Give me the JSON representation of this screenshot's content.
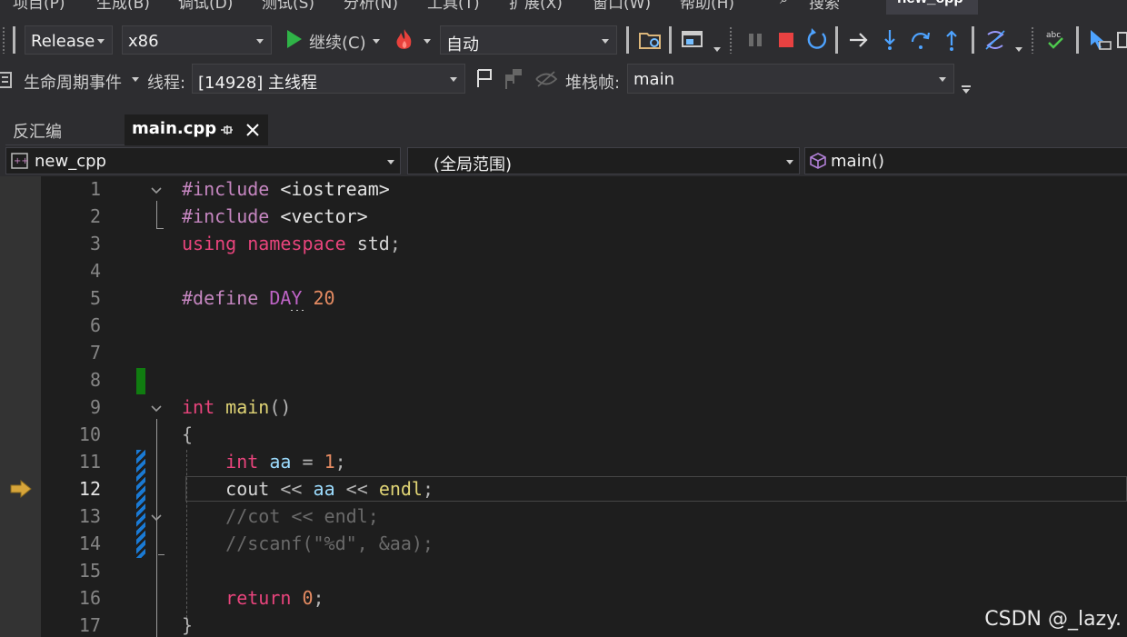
{
  "menubar": {
    "items": [
      "项目(P)",
      "生成(B)",
      "调试(D)",
      "测试(S)",
      "分析(N)",
      "工具(T)",
      "扩展(X)",
      "窗口(W)",
      "帮助(H)",
      "搜索"
    ],
    "project_name": "new_cpp"
  },
  "toolbar1": {
    "configuration": "Release",
    "platform": "x86",
    "continue_label": "继续(C)",
    "watch_mode": "自动"
  },
  "toolbar2": {
    "lifecycle_events_label": "生命周期事件",
    "thread_label": "线程:",
    "thread_value": "[14928] 主线程",
    "stack_frame_label": "堆栈帧:",
    "stack_frame_value": "main"
  },
  "tabs": [
    {
      "label": "反汇编"
    },
    {
      "label": "main.cpp",
      "active": true
    }
  ],
  "navbar": {
    "project": "new_cpp",
    "scope": "(全局范围)",
    "member": "main()"
  },
  "editor": {
    "current_line": 12,
    "line_numbers": [
      "1",
      "2",
      "3",
      "4",
      "5",
      "6",
      "7",
      "8",
      "9",
      "10",
      "11",
      "12",
      "13",
      "14",
      "15",
      "16",
      "17"
    ],
    "lines": [
      "#include <iostream>",
      "#include <vector>",
      "using namespace std;",
      "",
      "#define DAY 20",
      "",
      "",
      "",
      "int main()",
      "{",
      "    int aa = 1;",
      "    cout << aa << endl;",
      "    //cot << endl;",
      "    //scanf(\"%d\", &aa);",
      "",
      "    return 0;",
      "}"
    ]
  },
  "watermark": "CSDN @_lazy.",
  "colors": {
    "background": "#1e1e1e",
    "chrome": "#2d2d30",
    "keyword": "#569cd6",
    "current_line_arrow": "#d7ba7d",
    "change_marker_saved": "#107c10",
    "change_marker_blue": "#1a7ad4"
  }
}
